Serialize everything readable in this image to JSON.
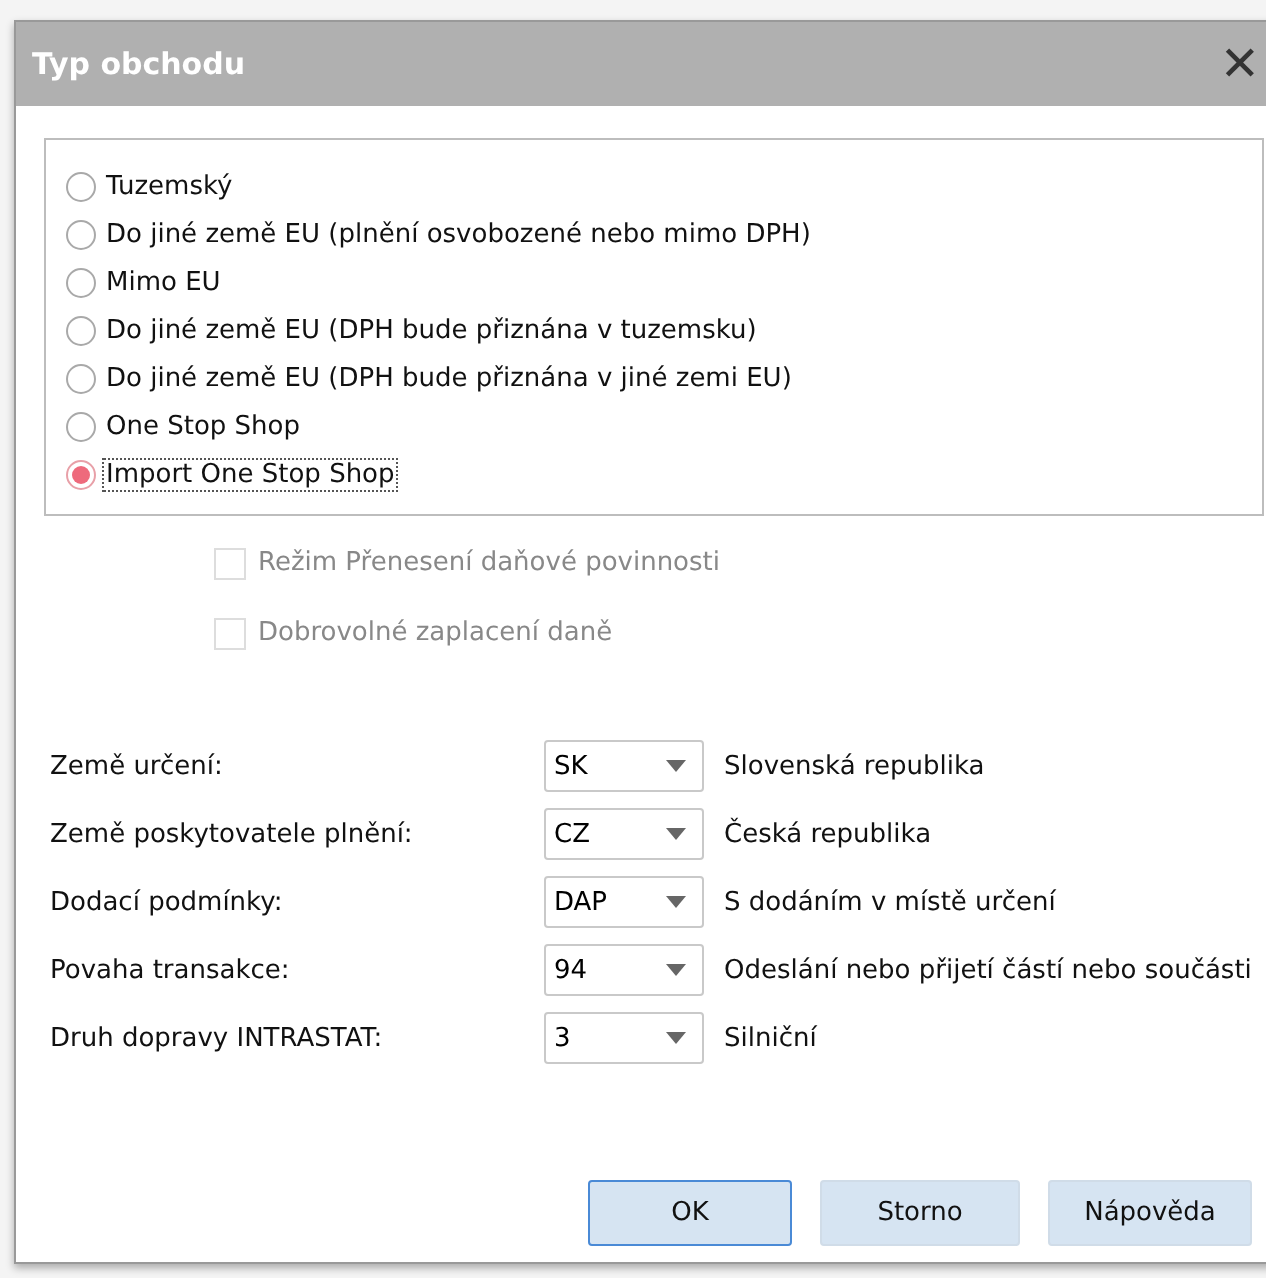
{
  "window": {
    "title": "Typ obchodu",
    "close": "✕"
  },
  "trade_types": [
    {
      "label": "Tuzemský",
      "selected": false
    },
    {
      "label": "Do jiné země EU (plnění osvobozené nebo mimo DPH)",
      "selected": false
    },
    {
      "label": "Mimo EU",
      "selected": false
    },
    {
      "label": "Do jiné země EU (DPH bude přiznána v tuzemsku)",
      "selected": false
    },
    {
      "label": "Do jiné země EU (DPH bude přiznána v jiné zemi EU)",
      "selected": false
    },
    {
      "label": "One Stop Shop",
      "selected": false
    },
    {
      "label": "Import One Stop Shop",
      "selected": true
    }
  ],
  "options": [
    {
      "label": "Režim Přenesení daňové povinnosti",
      "checked": false,
      "disabled": true
    },
    {
      "label": "Dobrovolné zaplacení daně",
      "checked": false,
      "disabled": true
    }
  ],
  "fields": [
    {
      "label": "Země určení:",
      "value": "SK",
      "description": "Slovenská republika"
    },
    {
      "label": "Země poskytovatele plnění:",
      "value": "CZ",
      "description": "Česká republika"
    },
    {
      "label": "Dodací podmínky:",
      "value": "DAP",
      "description": "S dodáním v místě určení"
    },
    {
      "label": "Povaha transakce:",
      "value": "94",
      "description": "Odeslání nebo přijetí částí nebo součásti"
    },
    {
      "label": "Druh dopravy INTRASTAT:",
      "value": "3",
      "description": "Silniční"
    }
  ],
  "buttons": [
    {
      "label": "OK",
      "default": true
    },
    {
      "label": "Storno",
      "default": false
    },
    {
      "label": "Nápověda",
      "default": false
    }
  ]
}
